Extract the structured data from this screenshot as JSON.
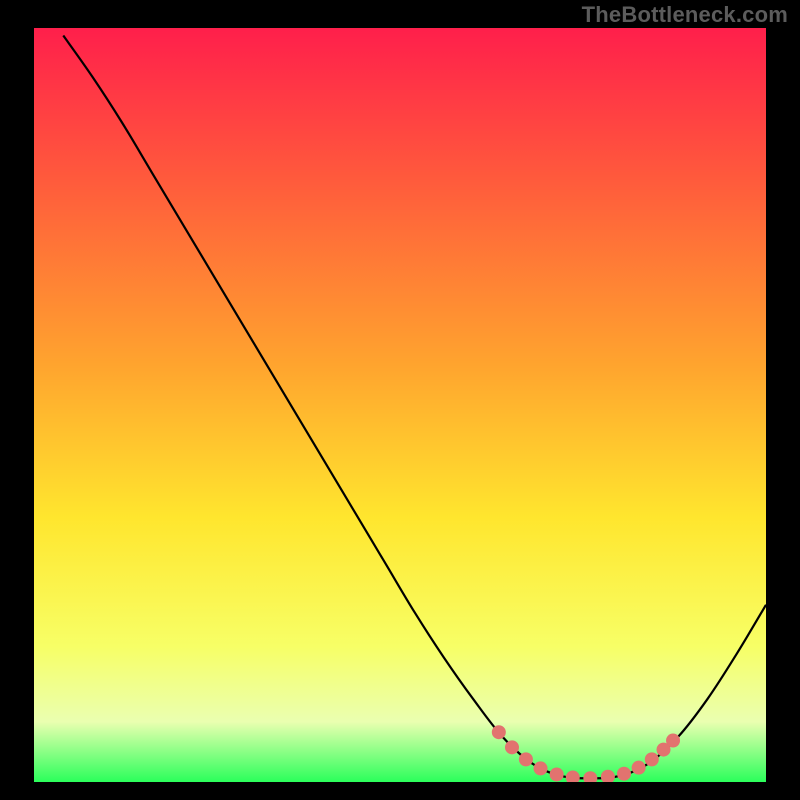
{
  "watermark": "TheBottleneck.com",
  "chart_data": {
    "type": "line",
    "title": "",
    "xlabel": "",
    "ylabel": "",
    "xlim": [
      0,
      100
    ],
    "ylim": [
      0,
      100
    ],
    "gradient_stops": [
      {
        "offset": 0,
        "color": "#ff1f4b"
      },
      {
        "offset": 20,
        "color": "#ff5a3c"
      },
      {
        "offset": 45,
        "color": "#ffa52e"
      },
      {
        "offset": 65,
        "color": "#ffe62e"
      },
      {
        "offset": 82,
        "color": "#f7ff66"
      },
      {
        "offset": 92,
        "color": "#eaffb0"
      },
      {
        "offset": 100,
        "color": "#2bff5b"
      }
    ],
    "series": [
      {
        "name": "bottleneck-curve",
        "color": "#000000",
        "points": [
          {
            "x": 4.0,
            "y": 99.0
          },
          {
            "x": 8.0,
            "y": 93.5
          },
          {
            "x": 12.0,
            "y": 87.5
          },
          {
            "x": 16.0,
            "y": 81.0
          },
          {
            "x": 20.0,
            "y": 74.5
          },
          {
            "x": 24.0,
            "y": 68.0
          },
          {
            "x": 28.0,
            "y": 61.5
          },
          {
            "x": 32.0,
            "y": 55.0
          },
          {
            "x": 36.0,
            "y": 48.5
          },
          {
            "x": 40.0,
            "y": 42.0
          },
          {
            "x": 44.0,
            "y": 35.5
          },
          {
            "x": 48.0,
            "y": 29.0
          },
          {
            "x": 52.0,
            "y": 22.5
          },
          {
            "x": 56.0,
            "y": 16.5
          },
          {
            "x": 60.0,
            "y": 11.0
          },
          {
            "x": 64.0,
            "y": 6.0
          },
          {
            "x": 68.0,
            "y": 2.5
          },
          {
            "x": 72.0,
            "y": 0.8
          },
          {
            "x": 76.0,
            "y": 0.5
          },
          {
            "x": 80.0,
            "y": 0.8
          },
          {
            "x": 84.0,
            "y": 2.5
          },
          {
            "x": 88.0,
            "y": 6.0
          },
          {
            "x": 92.0,
            "y": 11.0
          },
          {
            "x": 96.0,
            "y": 17.0
          },
          {
            "x": 100.0,
            "y": 23.5
          }
        ]
      },
      {
        "name": "highlight-dots",
        "color": "#e2736f",
        "radius": 7,
        "points": [
          {
            "x": 63.5,
            "y": 6.6
          },
          {
            "x": 65.3,
            "y": 4.6
          },
          {
            "x": 67.2,
            "y": 3.0
          },
          {
            "x": 69.2,
            "y": 1.8
          },
          {
            "x": 71.4,
            "y": 1.0
          },
          {
            "x": 73.6,
            "y": 0.6
          },
          {
            "x": 76.0,
            "y": 0.5
          },
          {
            "x": 78.4,
            "y": 0.7
          },
          {
            "x": 80.6,
            "y": 1.1
          },
          {
            "x": 82.6,
            "y": 1.9
          },
          {
            "x": 84.4,
            "y": 3.0
          },
          {
            "x": 86.0,
            "y": 4.3
          },
          {
            "x": 87.3,
            "y": 5.5
          }
        ]
      }
    ]
  }
}
